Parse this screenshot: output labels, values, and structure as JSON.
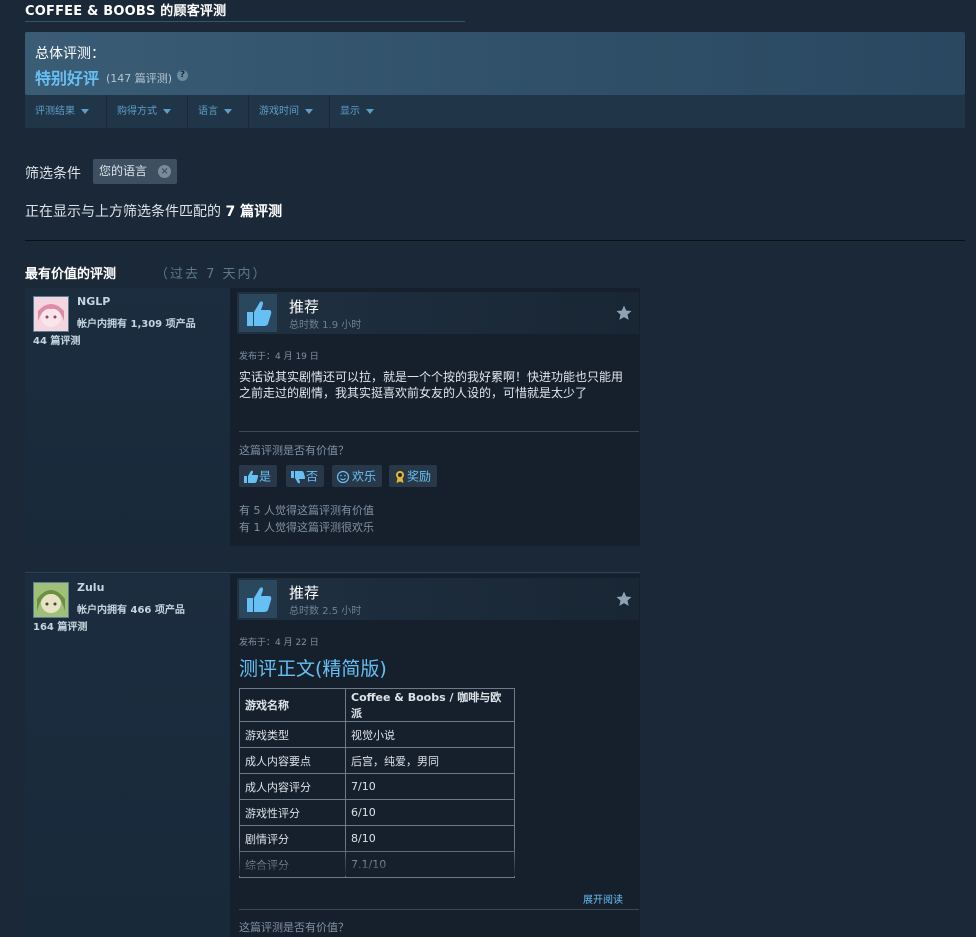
{
  "page": {
    "title": "COFFEE & BOOBS 的顾客评测"
  },
  "summary": {
    "label": "总体评测：",
    "score": "特别好评",
    "count": "(147 篇评测)",
    "help": "?"
  },
  "filters": {
    "dropdowns": [
      "评测结果",
      "购得方式",
      "语言",
      "游戏时间",
      "显示"
    ],
    "condition_label": "筛选条件",
    "active_chip": "您的语言",
    "showing_prefix": "正在显示与上方筛选条件匹配的 ",
    "showing_count": "7 篇评测",
    "showing_suffix": ""
  },
  "section": {
    "title": "最有价值的评测",
    "subtitle": "（过去 7 天内）"
  },
  "reviews": [
    {
      "author": "NGLP",
      "products": "帐户内拥有 1,309 项产品",
      "review_count": "44 篇评测",
      "verdict": "推荐",
      "hours": "总时数 1.9 小时",
      "posted": "发布于：4 月 19 日",
      "body": "实话说其实剧情还可以拉，就是一个个按的我好累啊！快进功能也只能用之前走过的剧情，我其实挺喜欢前女友的人设的，可惜就是太少了",
      "helpful_question": "这篇评测是否有价值？",
      "buttons": {
        "yes": "是",
        "no": "否",
        "funny": "欢乐",
        "award": "奖励"
      },
      "helpful_stat": "有 5 人觉得这篇评测有价值",
      "funny_stat": "有 1 人觉得这篇评测很欢乐"
    },
    {
      "author": "Zulu",
      "products": "帐户内拥有 466 项产品",
      "review_count": "164 篇评测",
      "verdict": "推荐",
      "hours": "总时数 2.5 小时",
      "posted": "发布于：4 月 22 日",
      "heading": "测评正文(精简版)",
      "table": [
        [
          "游戏名称",
          "Coffee & Boobs / 咖啡与欧派"
        ],
        [
          "游戏类型",
          "视觉小说"
        ],
        [
          "成人内容要点",
          "后宫，纯爱，男同"
        ],
        [
          "成人内容评分",
          "7/10"
        ],
        [
          "游戏性评分",
          "6/10"
        ],
        [
          "剧情评分",
          "8/10"
        ],
        [
          "综合评分",
          "7.1/10"
        ]
      ],
      "expand": "展开阅读",
      "helpful_question": "这篇评测是否有价值？"
    }
  ],
  "colors": {
    "bg": "#1b2838",
    "accent": "#66c0f4",
    "panel": "#16202d"
  }
}
